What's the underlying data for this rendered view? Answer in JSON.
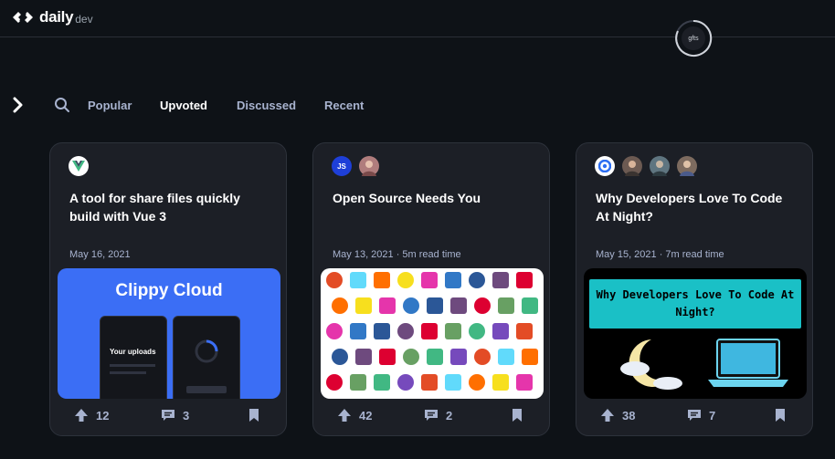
{
  "app": {
    "logo_text": "daily",
    "logo_suffix": "dev",
    "avatar_text": "gfts"
  },
  "filters": {
    "tabs": [
      {
        "label": "Popular",
        "active": false
      },
      {
        "label": "Upvoted",
        "active": true
      },
      {
        "label": "Discussed",
        "active": false
      },
      {
        "label": "Recent",
        "active": false
      }
    ]
  },
  "cards": [
    {
      "title": "A tool for share files quickly build with Vue 3",
      "meta": "May 16, 2021",
      "upvotes": "12",
      "comments": "3",
      "thumb": {
        "heading": "Clippy Cloud",
        "panel_text": "Your uploads"
      }
    },
    {
      "title": "Open Source Needs You",
      "meta": "May 13, 2021 · 5m read time",
      "upvotes": "42",
      "comments": "2",
      "source_badge": "JS"
    },
    {
      "title": "Why Developers Love To Code At Night?",
      "meta": "May 15, 2021 · 7m read time",
      "upvotes": "38",
      "comments": "7",
      "thumb": {
        "banner": "Why Developers Love To Code At Night?"
      }
    }
  ],
  "colors": {
    "background": "#0e1217",
    "card": "#1c1f26",
    "accent": "#3b6ef5",
    "vue_green": "#41b883",
    "banner_cyan": "#1ac0c6"
  }
}
